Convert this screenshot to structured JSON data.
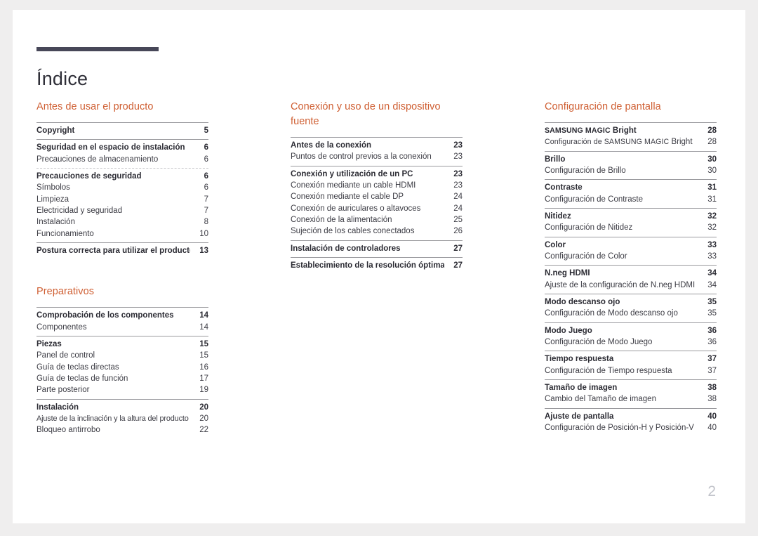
{
  "document": {
    "title": "Índice",
    "page_number": "2",
    "accent_color": "#cf5f33",
    "rule_color": "#474758",
    "page_number_color": "#c2c4cb"
  },
  "columns": [
    {
      "sections": [
        {
          "heading": "Antes de usar el producto",
          "groups": [
            {
              "divider": "solid",
              "entries": [
                {
                  "label": "Copyright",
                  "page": "5",
                  "level": "major"
                }
              ]
            },
            {
              "divider": "solid",
              "entries": [
                {
                  "label": "Seguridad en el espacio de instalación",
                  "page": "6",
                  "level": "major"
                },
                {
                  "label": "Precauciones de almacenamiento",
                  "page": "6",
                  "level": "minor"
                }
              ]
            },
            {
              "divider": "dashed",
              "entries": [
                {
                  "label": "Precauciones de seguridad",
                  "page": "6",
                  "level": "major"
                },
                {
                  "label": "Símbolos",
                  "page": "6",
                  "level": "minor"
                },
                {
                  "label": "Limpieza",
                  "page": "7",
                  "level": "minor"
                },
                {
                  "label": "Electricidad y seguridad",
                  "page": "7",
                  "level": "minor"
                },
                {
                  "label": "Instalación",
                  "page": "8",
                  "level": "minor"
                },
                {
                  "label": "Funcionamiento",
                  "page": "10",
                  "level": "minor"
                }
              ]
            },
            {
              "divider": "solid",
              "entries": [
                {
                  "label": "Postura correcta para utilizar el producto",
                  "page": "13",
                  "level": "major"
                }
              ]
            }
          ]
        },
        {
          "heading": "Preparativos",
          "groups": [
            {
              "divider": "solid",
              "entries": [
                {
                  "label": "Comprobación de los componentes",
                  "page": "14",
                  "level": "major"
                },
                {
                  "label": "Componentes",
                  "page": "14",
                  "level": "minor"
                }
              ]
            },
            {
              "divider": "solid",
              "entries": [
                {
                  "label": "Piezas",
                  "page": "15",
                  "level": "major"
                },
                {
                  "label": "Panel de control",
                  "page": "15",
                  "level": "minor"
                },
                {
                  "label": "Guía de teclas directas",
                  "page": "16",
                  "level": "minor"
                },
                {
                  "label": "Guía de teclas de función",
                  "page": "17",
                  "level": "minor"
                },
                {
                  "label": "Parte posterior",
                  "page": "19",
                  "level": "minor"
                }
              ]
            },
            {
              "divider": "solid",
              "entries": [
                {
                  "label": "Instalación",
                  "page": "20",
                  "level": "major"
                },
                {
                  "label": "Ajuste de la inclinación y la altura del producto",
                  "page": "20",
                  "level": "minor",
                  "tight": true
                },
                {
                  "label": "Bloqueo antirrobo",
                  "page": "22",
                  "level": "minor"
                }
              ]
            }
          ]
        }
      ]
    },
    {
      "sections": [
        {
          "heading": "Conexión y uso de un dispositivo fuente",
          "groups": [
            {
              "divider": "solid",
              "entries": [
                {
                  "label": "Antes de la conexión",
                  "page": "23",
                  "level": "major"
                },
                {
                  "label": "Puntos de control previos a la conexión",
                  "page": "23",
                  "level": "minor"
                }
              ]
            },
            {
              "divider": "solid",
              "entries": [
                {
                  "label": "Conexión y utilización de un PC",
                  "page": "23",
                  "level": "major"
                },
                {
                  "label": "Conexión mediante un cable HDMI",
                  "page": "23",
                  "level": "minor"
                },
                {
                  "label": "Conexión mediante el cable DP",
                  "page": "24",
                  "level": "minor"
                },
                {
                  "label": "Conexión de auriculares o altavoces",
                  "page": "24",
                  "level": "minor"
                },
                {
                  "label": "Conexión de la alimentación",
                  "page": "25",
                  "level": "minor"
                },
                {
                  "label": "Sujeción de los cables conectados",
                  "page": "26",
                  "level": "minor"
                }
              ]
            },
            {
              "divider": "solid",
              "entries": [
                {
                  "label": "Instalación de controladores",
                  "page": "27",
                  "level": "major"
                }
              ]
            },
            {
              "divider": "solid",
              "entries": [
                {
                  "label": "Establecimiento de la resolución óptima",
                  "page": "27",
                  "level": "major"
                }
              ]
            }
          ]
        }
      ]
    },
    {
      "sections": [
        {
          "heading": "Configuración de pantalla",
          "groups": [
            {
              "divider": "solid",
              "entries": [
                {
                  "label": "SAMSUNG MAGIC Bright",
                  "page": "28",
                  "level": "major",
                  "smallcaps_prefix": "SAMSUNG MAGIC",
                  "rest": " Bright"
                },
                {
                  "label": "Configuración de SAMSUNG MAGIC Bright",
                  "page": "28",
                  "level": "minor",
                  "smallcaps_prefix": "Configuración de SAMSUNG MAGIC",
                  "rest": " Bright"
                }
              ]
            },
            {
              "divider": "solid",
              "entries": [
                {
                  "label": "Brillo",
                  "page": "30",
                  "level": "major"
                },
                {
                  "label": "Configuración de Brillo",
                  "page": "30",
                  "level": "minor"
                }
              ]
            },
            {
              "divider": "solid",
              "entries": [
                {
                  "label": "Contraste",
                  "page": "31",
                  "level": "major"
                },
                {
                  "label": "Configuración de Contraste",
                  "page": "31",
                  "level": "minor"
                }
              ]
            },
            {
              "divider": "solid",
              "entries": [
                {
                  "label": "Nitidez",
                  "page": "32",
                  "level": "major"
                },
                {
                  "label": "Configuración de Nitidez",
                  "page": "32",
                  "level": "minor"
                }
              ]
            },
            {
              "divider": "solid",
              "entries": [
                {
                  "label": "Color",
                  "page": "33",
                  "level": "major"
                },
                {
                  "label": "Configuración de Color",
                  "page": "33",
                  "level": "minor"
                }
              ]
            },
            {
              "divider": "solid",
              "entries": [
                {
                  "label": "N.neg HDMI",
                  "page": "34",
                  "level": "major"
                },
                {
                  "label": "Ajuste de la configuración de N.neg HDMI",
                  "page": "34",
                  "level": "minor"
                }
              ]
            },
            {
              "divider": "solid",
              "entries": [
                {
                  "label": "Modo descanso ojo",
                  "page": "35",
                  "level": "major"
                },
                {
                  "label": "Configuración de Modo descanso ojo",
                  "page": "35",
                  "level": "minor"
                }
              ]
            },
            {
              "divider": "solid",
              "entries": [
                {
                  "label": "Modo Juego",
                  "page": "36",
                  "level": "major"
                },
                {
                  "label": "Configuración de Modo Juego",
                  "page": "36",
                  "level": "minor"
                }
              ]
            },
            {
              "divider": "solid",
              "entries": [
                {
                  "label": "Tiempo respuesta",
                  "page": "37",
                  "level": "major"
                },
                {
                  "label": "Configuración de Tiempo respuesta",
                  "page": "37",
                  "level": "minor"
                }
              ]
            },
            {
              "divider": "solid",
              "entries": [
                {
                  "label": "Tamaño de imagen",
                  "page": "38",
                  "level": "major"
                },
                {
                  "label": "Cambio del Tamaño de imagen",
                  "page": "38",
                  "level": "minor"
                }
              ]
            },
            {
              "divider": "solid",
              "entries": [
                {
                  "label": "Ajuste de pantalla",
                  "page": "40",
                  "level": "major"
                },
                {
                  "label": "Configuración de Posición-H y Posición-V",
                  "page": "40",
                  "level": "minor"
                }
              ]
            }
          ]
        }
      ]
    }
  ]
}
